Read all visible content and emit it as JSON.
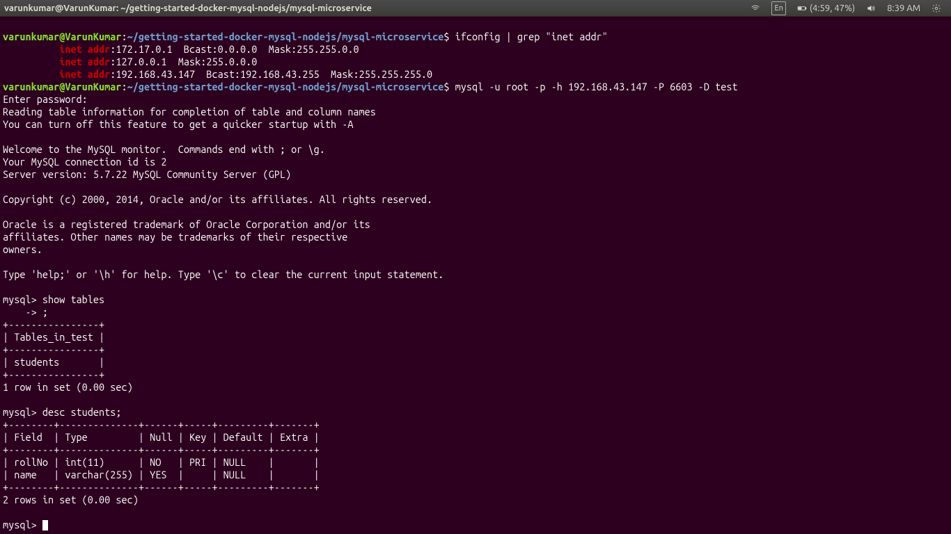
{
  "menubar": {
    "title": "varunkumar@VarunKumar: ~/getting-started-docker-mysql-nodejs/mysql-microservice",
    "lang": "En",
    "battery": "(4:59, 47%)",
    "time": "8:39 AM"
  },
  "prompt": {
    "user": "varunkumar@VarunKumar",
    "sep": ":",
    "path": "~/getting-started-docker-mysql-nodejs/mysql-microservice",
    "dollar": "$"
  },
  "cmd1": " ifconfig | grep \"inet addr\"",
  "ifconfig": {
    "indent": "          ",
    "label": "inet addr",
    "l1": ":172.17.0.1  Bcast:0.0.0.0  Mask:255.255.0.0",
    "l2": ":127.0.0.1  Mask:255.0.0.0",
    "l3": ":192.168.43.147  Bcast:192.168.43.255  Mask:255.255.255.0"
  },
  "cmd2": " mysql -u root -p -h 192.168.43.147 -P 6603 -D test",
  "mysql_intro": "Enter password: \nReading table information for completion of table and column names\nYou can turn off this feature to get a quicker startup with -A\n\nWelcome to the MySQL monitor.  Commands end with ; or \\g.\nYour MySQL connection id is 2\nServer version: 5.7.22 MySQL Community Server (GPL)\n\nCopyright (c) 2000, 2014, Oracle and/or its affiliates. All rights reserved.\n\nOracle is a registered trademark of Oracle Corporation and/or its\naffiliates. Other names may be trademarks of their respective\nowners.\n\nType 'help;' or '\\h' for help. Type '\\c' to clear the current input statement.\n",
  "show_tables": "mysql> show tables\n    -> ;\n+----------------+\n| Tables_in_test |\n+----------------+\n| students       |\n+----------------+\n1 row in set (0.00 sec)\n",
  "desc_students": "mysql> desc students;\n+--------+--------------+------+-----+---------+-------+\n| Field  | Type         | Null | Key | Default | Extra |\n+--------+--------------+------+-----+---------+-------+\n| rollNo | int(11)      | NO   | PRI | NULL    |       |\n| name   | varchar(255) | YES  |     | NULL    |       |\n+--------+--------------+------+-----+---------+-------+\n2 rows in set (0.00 sec)\n",
  "final_prompt": "mysql> "
}
